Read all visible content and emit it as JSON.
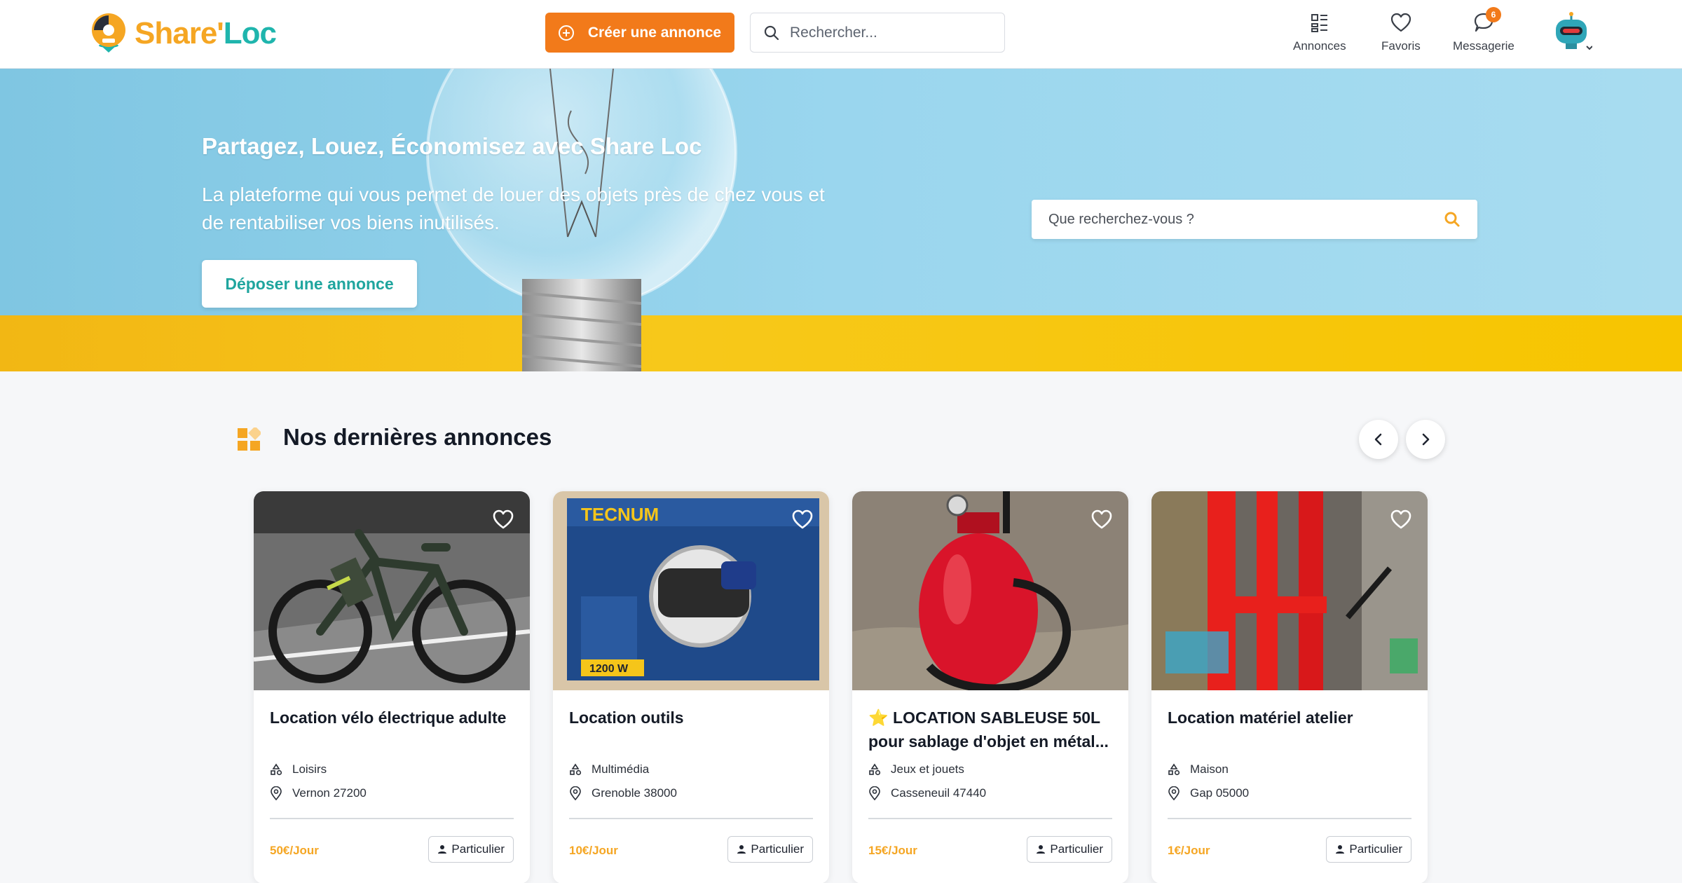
{
  "header": {
    "logo": {
      "part1": "Share'",
      "part2": "Loc"
    },
    "create_label": "Créer une annonce",
    "search_placeholder": "Rechercher...",
    "nav": [
      {
        "label": "Annonces",
        "icon": "grid-list-icon"
      },
      {
        "label": "Favoris",
        "icon": "heart-icon"
      },
      {
        "label": "Messagerie",
        "icon": "chat-bubble-icon",
        "badge": "6"
      }
    ]
  },
  "hero": {
    "title": "Partagez, Louez, Économisez avec Share Loc",
    "subtitle": "La plateforme qui vous permet de louer des objets près de chez vous et de rentabiliser vos biens inutilisés.",
    "cta_label": "Déposer une annonce",
    "search_placeholder": "Que recherchez-vous ?"
  },
  "section": {
    "title": "Nos dernières annonces"
  },
  "listings": [
    {
      "title": "Location vélo électrique adulte",
      "category": "Loisirs",
      "location": "Vernon 27200",
      "price": "50€/Jour",
      "seller": "Particulier"
    },
    {
      "title": "Location outils",
      "category": "Multimédia",
      "location": "Grenoble 38000",
      "price": "10€/Jour",
      "seller": "Particulier"
    },
    {
      "title": "⭐ LOCATION SABLEUSE 50L pour sablage d'objet en métal...",
      "category": "Jeux et jouets",
      "location": "Casseneuil 47440",
      "price": "15€/Jour",
      "seller": "Particulier"
    },
    {
      "title": "Location matériel atelier",
      "category": "Maison",
      "location": "Gap 05000",
      "price": "1€/Jour",
      "seller": "Particulier"
    }
  ],
  "colors": {
    "accent_orange": "#f27a1a",
    "brand_teal": "#1fb5ad",
    "price_orange": "#f5a623"
  }
}
